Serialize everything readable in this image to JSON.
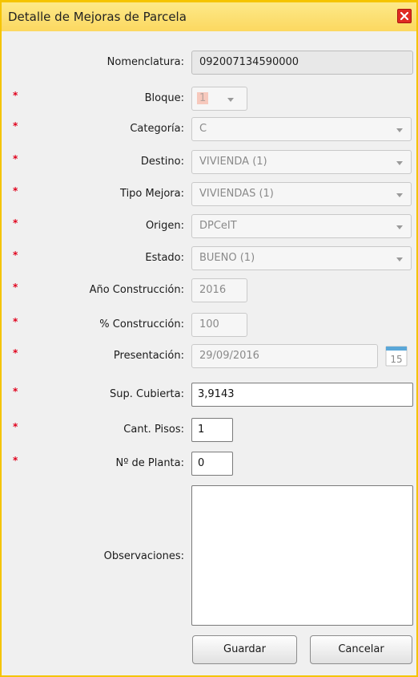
{
  "window": {
    "title": "Detalle de Mejoras de Parcela"
  },
  "colors": {
    "required": "#e0001b",
    "titlebar": "#fcd860",
    "close": "#e02b23"
  },
  "form": {
    "nomenclatura": {
      "label": "Nomenclatura:",
      "value": "092007134590000"
    },
    "bloque": {
      "label": "Bloque:",
      "value": "1"
    },
    "categoria": {
      "label": "Categoría:",
      "value": "C"
    },
    "destino": {
      "label": "Destino:",
      "value": "VIVIENDA (1)"
    },
    "tipo_mejora": {
      "label": "Tipo Mejora:",
      "value": "VIVIENDAS (1)"
    },
    "origen": {
      "label": "Origen:",
      "value": "DPCeIT"
    },
    "estado": {
      "label": "Estado:",
      "value": "BUENO (1)"
    },
    "anio_construccion": {
      "label": "Año Construcción:",
      "value": "2016"
    },
    "pct_construccion": {
      "label": "% Construcción:",
      "value": "100"
    },
    "presentacion": {
      "label": "Presentación:",
      "value": "29/09/2016",
      "calendar_day": "15"
    },
    "sup_cubierta": {
      "label": "Sup. Cubierta:",
      "value": "3,9143"
    },
    "cant_pisos": {
      "label": "Cant. Pisos:",
      "value": "1"
    },
    "nro_planta": {
      "label": "Nº de Planta:",
      "value": "0"
    },
    "observaciones": {
      "label": "Observaciones:",
      "value": ""
    }
  },
  "required_marker": "*",
  "buttons": {
    "save": "Guardar",
    "cancel": "Cancelar"
  },
  "icons": {
    "close": "close-icon",
    "calendar": "calendar-icon",
    "dropdown": "chevron-down-icon"
  }
}
